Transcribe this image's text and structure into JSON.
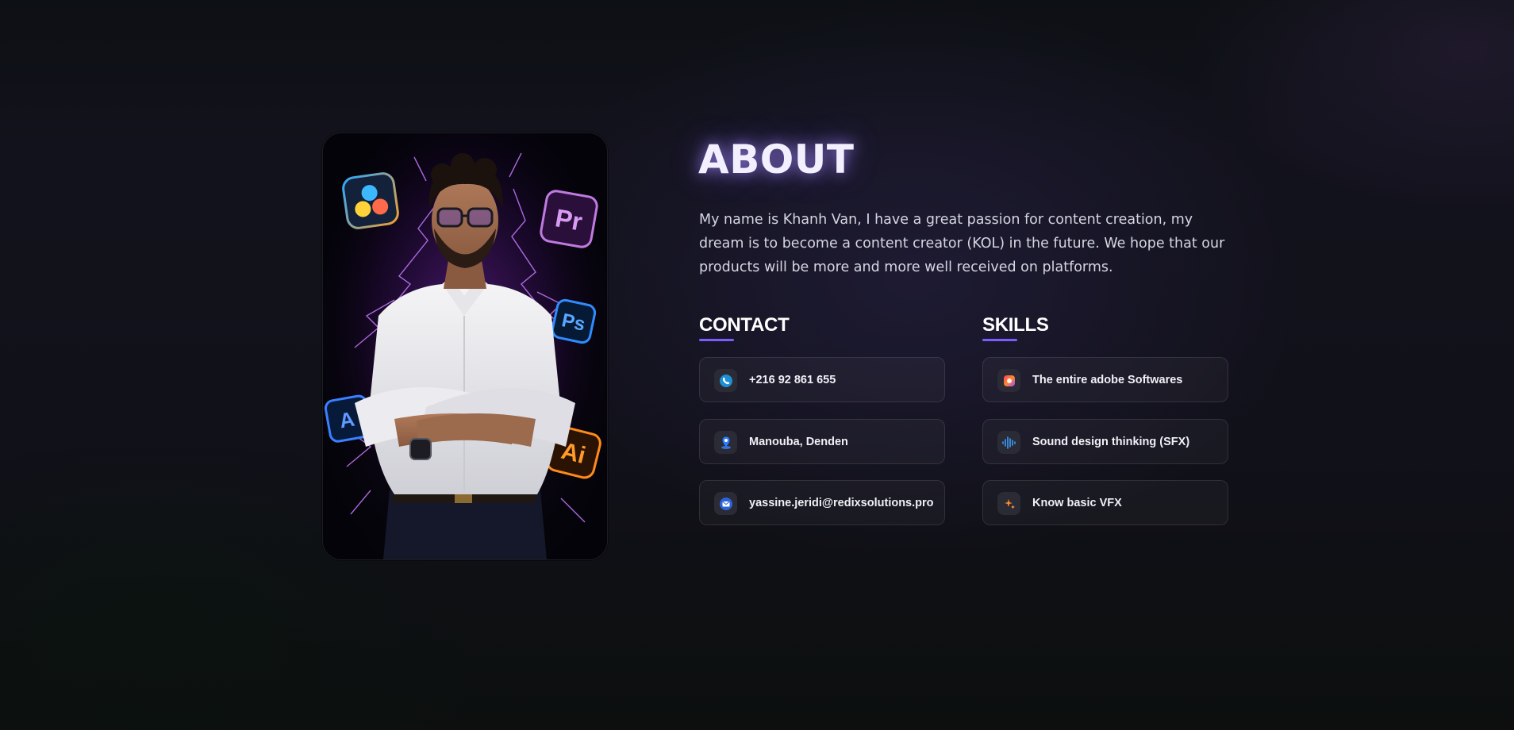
{
  "about": {
    "title": "ABOUT",
    "description": "My name is Khanh Van, I have a great passion for content creation, my dream is to become a content creator (KOL) in the future. We hope that our products will be more and more well received on platforms."
  },
  "photo": {
    "icon_labels": {
      "premiere": "Pr",
      "photoshop": "Ps",
      "illustrator": "Ai",
      "after_effects": "A"
    }
  },
  "contact": {
    "title": "CONTACT",
    "items": [
      {
        "icon": "phone-icon",
        "label": "+216 92 861 655"
      },
      {
        "icon": "location-pin-icon",
        "label": "Manouba, Denden"
      },
      {
        "icon": "mail-icon",
        "label": "yassine.jeridi@redixsolutions.pro"
      }
    ]
  },
  "skills": {
    "title": "SKILLS",
    "items": [
      {
        "icon": "adobe-cloud-icon",
        "label": "The entire adobe Softwares"
      },
      {
        "icon": "sound-wave-icon",
        "label": "Sound design thinking (SFX)"
      },
      {
        "icon": "sparkles-icon",
        "label": "Know basic VFX"
      }
    ]
  },
  "colors": {
    "accent": "#7c5cff",
    "background": "#11111a",
    "card": "#1a1a22",
    "text": "#d6d6e2"
  }
}
